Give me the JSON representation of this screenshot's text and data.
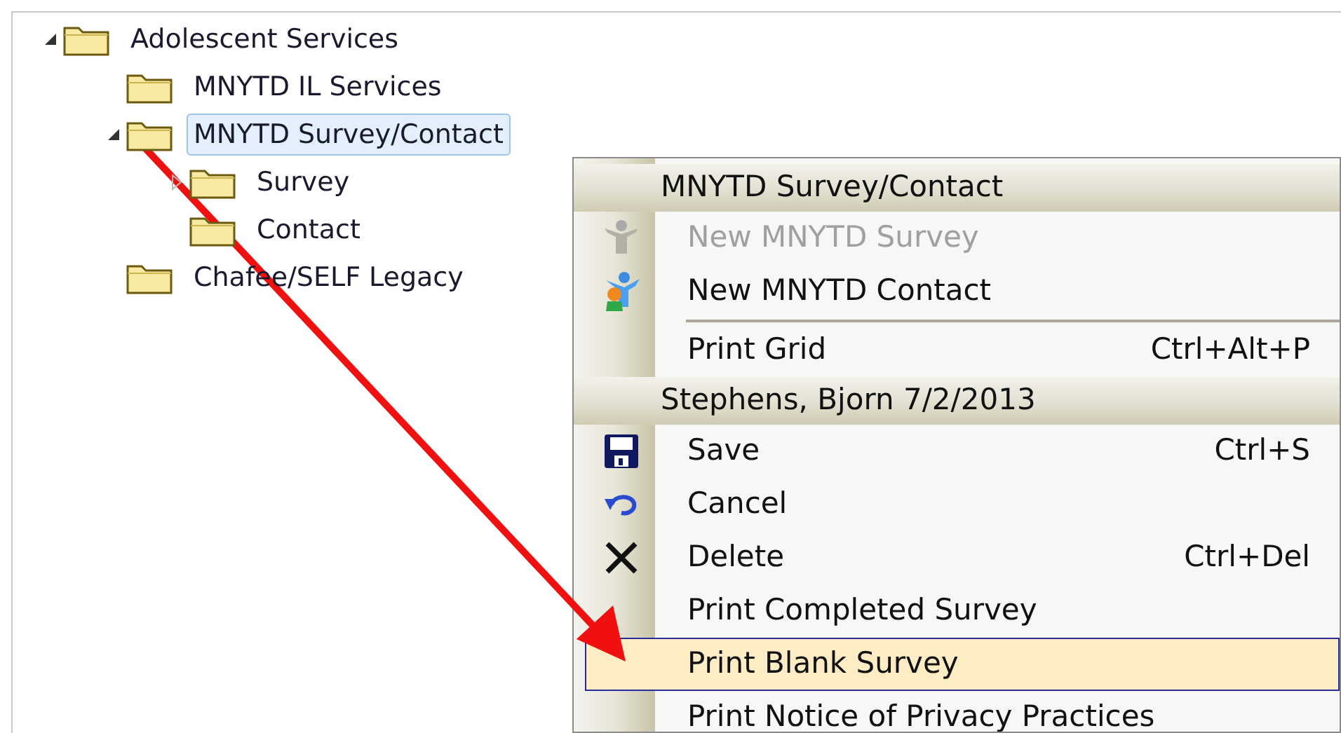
{
  "tree": [
    {
      "label": "Adolescent Services",
      "expanded": true,
      "selected": false,
      "children": [
        {
          "label": "MNYTD IL Services",
          "selected": false
        },
        {
          "label": "MNYTD Survey/Contact",
          "expanded": true,
          "selected": true,
          "children": [
            {
              "label": "Survey",
              "expanded": false,
              "selected": false
            },
            {
              "label": "Contact",
              "selected": false
            }
          ]
        },
        {
          "label": "Chafee/SELF Legacy",
          "selected": false
        }
      ]
    }
  ],
  "context_menu": {
    "items": [
      {
        "kind": "header",
        "label": "MNYTD Survey/Contact"
      },
      {
        "kind": "item",
        "label": "New MNYTD Survey",
        "disabled": true,
        "selected": false
      },
      {
        "kind": "item",
        "label": "New MNYTD Contact",
        "disabled": false,
        "selected": false
      },
      {
        "kind": "separator"
      },
      {
        "kind": "item",
        "label": "Print Grid",
        "shortcut": "Ctrl+Alt+P",
        "disabled": false,
        "selected": false
      },
      {
        "kind": "header",
        "label": "Stephens, Bjorn 7/2/2013"
      },
      {
        "kind": "item",
        "label": "Save",
        "shortcut": "Ctrl+S",
        "disabled": false,
        "selected": false
      },
      {
        "kind": "item",
        "label": "Cancel",
        "disabled": false,
        "selected": false
      },
      {
        "kind": "item",
        "label": "Delete",
        "shortcut": "Ctrl+Del",
        "disabled": false,
        "selected": false
      },
      {
        "kind": "item",
        "label": "Print Completed Survey",
        "disabled": false,
        "selected": false
      },
      {
        "kind": "item",
        "label": "Print Blank Survey",
        "disabled": false,
        "selected": true
      },
      {
        "kind": "item",
        "label": "Print Notice of Privacy Practices",
        "disabled": false,
        "selected": false
      }
    ]
  }
}
